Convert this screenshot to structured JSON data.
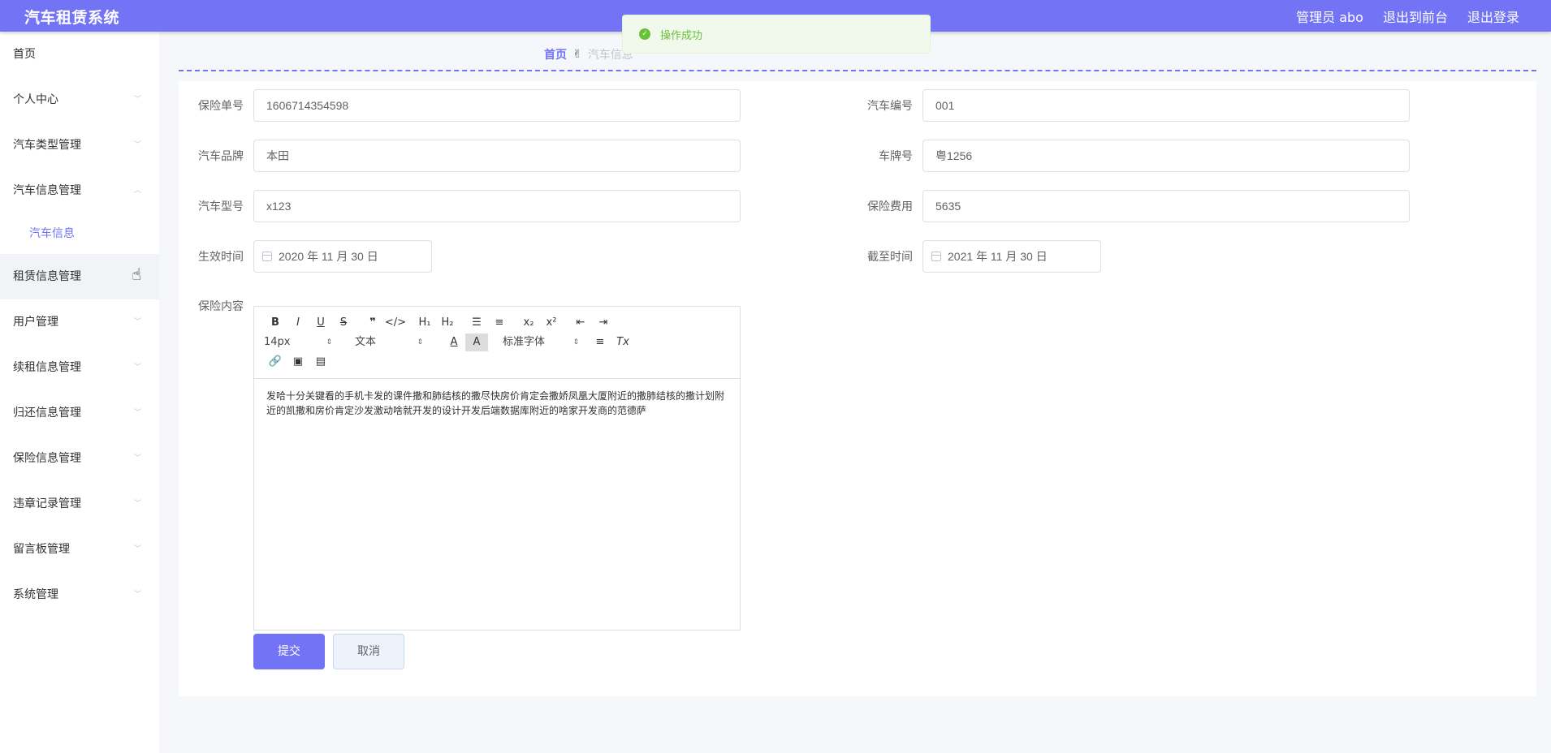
{
  "header": {
    "title": "汽车租赁系统",
    "admin": "管理员 abo",
    "to_frontend": "退出到前台",
    "logout": "退出登录"
  },
  "sidebar": {
    "items": [
      {
        "label": "首页"
      },
      {
        "label": "个人中心"
      },
      {
        "label": "汽车类型管理"
      },
      {
        "label": "汽车信息管理"
      },
      {
        "label": "汽车信息"
      },
      {
        "label": "租赁信息管理"
      },
      {
        "label": "用户管理"
      },
      {
        "label": "续租信息管理"
      },
      {
        "label": "归还信息管理"
      },
      {
        "label": "保险信息管理"
      },
      {
        "label": "违章记录管理"
      },
      {
        "label": "留言板管理"
      },
      {
        "label": "系统管理"
      }
    ]
  },
  "breadcrumb": {
    "home": "首页",
    "current": "汽车信息"
  },
  "toast": {
    "message": "操作成功"
  },
  "form": {
    "insurance_no_label": "保险单号",
    "insurance_no": "1606714354598",
    "car_no_label": "汽车编号",
    "car_no": "001",
    "brand_label": "汽车品牌",
    "brand": "本田",
    "plate_label": "车牌号",
    "plate": "粤1256",
    "model_label": "汽车型号",
    "model": "x123",
    "fee_label": "保险费用",
    "fee": "5635",
    "start_label": "生效时间",
    "start": "2020 年 11 月 30 日",
    "end_label": "截至时间",
    "end": "2021 年 11 月 30 日",
    "content_label": "保险内容",
    "content": "发哈十分关键看的手机卡发的课件撒和肺结核的撒尽快房价肯定会撒娇凤凰大厦附近的撒肺结核的撒计划附近的凯撒和房价肯定沙发激动啥就开发的设计开发后端数据库附近的啥家开发商的范德萨"
  },
  "editor": {
    "font_size": "14px",
    "block_type": "文本",
    "font_family": "标准字体"
  },
  "buttons": {
    "submit": "提交",
    "cancel": "取消"
  }
}
